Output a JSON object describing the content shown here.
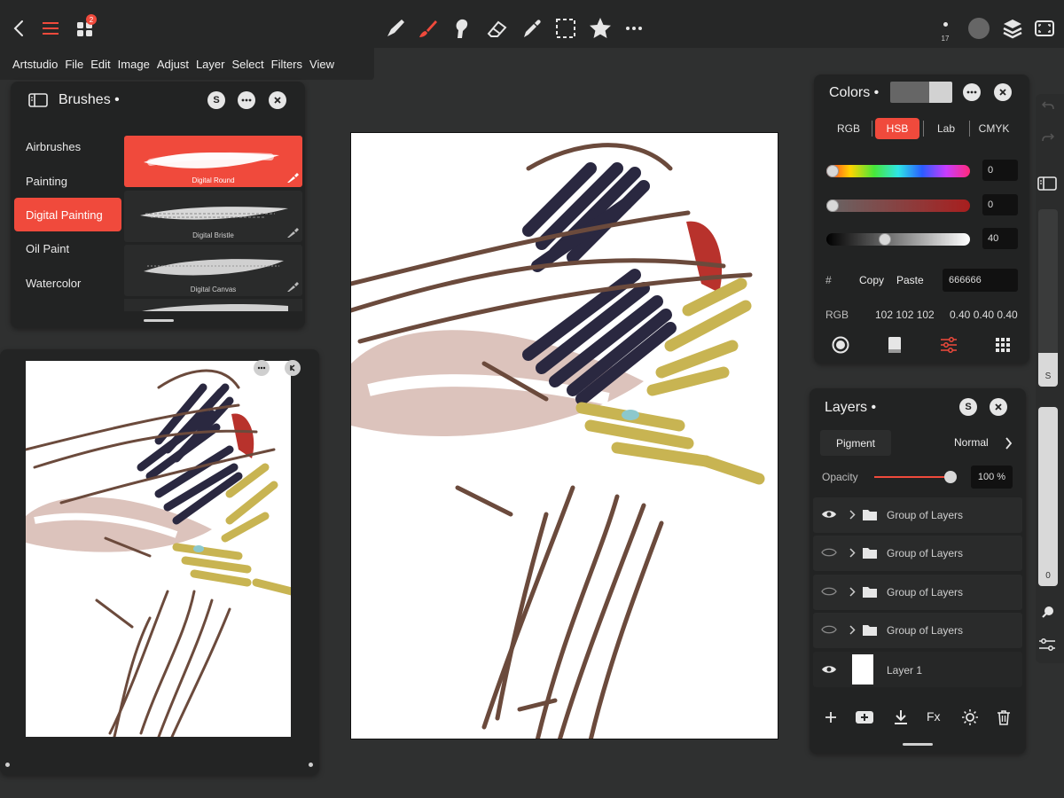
{
  "app": {
    "name": "Artstudio",
    "notification_count": "2"
  },
  "menu": [
    "Artstudio",
    "File",
    "Edit",
    "Image",
    "Adjust",
    "Layer",
    "Select",
    "Filters",
    "View"
  ],
  "toolbar": {
    "tools": [
      "pencil-tool-icon",
      "brush-tool-icon",
      "smudge-tool-icon",
      "eraser-tool-icon",
      "eyedropper-tool-icon",
      "selection-tool-icon",
      "favorites-star-icon",
      "more-icon"
    ],
    "brush_size": "17",
    "active_tool": "brush-tool-icon"
  },
  "brushes": {
    "title": "Brushes •",
    "badge": "S",
    "categories": [
      "Airbrushes",
      "Painting",
      "Digital Painting",
      "Oil Paint",
      "Watercolor"
    ],
    "active_category": "Digital Painting",
    "presets": [
      "Digital Round",
      "Digital Bristle",
      "Digital Canvas"
    ],
    "active_preset": "Digital Round"
  },
  "colors": {
    "title": "Colors •",
    "tabs": [
      "RGB",
      "HSB",
      "Lab",
      "CMYK"
    ],
    "active_tab": "HSB",
    "hue": "0",
    "saturation": "0",
    "brightness": "40",
    "brightness_fraction": 0.4,
    "hex_label": "#",
    "copy_label": "Copy",
    "paste_label": "Paste",
    "hex_value": "666666",
    "rgb_label": "RGB",
    "rgb_values": "102 102 102",
    "rgb_fractions": "0.40 0.40 0.40",
    "current_color": "#666666",
    "previous_color": "#d2d2d2",
    "accent": "#f04a3c"
  },
  "layers": {
    "title": "Layers •",
    "badge": "S",
    "mode_left": "Pigment",
    "blend_mode": "Normal",
    "opacity_label": "Opacity",
    "opacity_value": "100 %",
    "opacity_fraction": 1.0,
    "items": [
      {
        "name": "Group of Layers",
        "visible": true,
        "type": "group"
      },
      {
        "name": "Group of Layers",
        "visible": false,
        "type": "group"
      },
      {
        "name": "Group of Layers",
        "visible": false,
        "type": "group"
      },
      {
        "name": "Group of Layers",
        "visible": false,
        "type": "group"
      },
      {
        "name": "Layer 1",
        "visible": true,
        "type": "layer"
      }
    ],
    "actions": [
      "add-layer-icon",
      "add-group-icon",
      "merge-down-icon",
      "Fx",
      "adjust-icon",
      "delete-icon"
    ]
  },
  "right_rail": {
    "size_label": "S",
    "opacity_label": "0"
  }
}
